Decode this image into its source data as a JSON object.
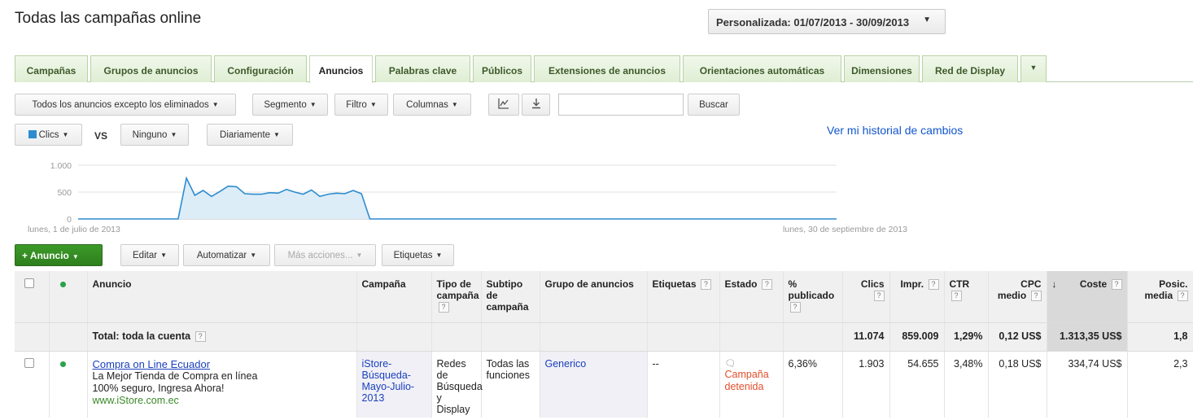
{
  "page_title": "Todas las campañas online",
  "date_range": {
    "label": "Personalizada: 01/07/2013 - 30/09/2013"
  },
  "tabs": [
    "Campañas",
    "Grupos de anuncios",
    "Configuración",
    "Anuncios",
    "Palabras clave",
    "Públicos",
    "Extensiones de anuncios",
    "Orientaciones automáticas",
    "Dimensiones",
    "Red de Display"
  ],
  "tabs_active": "Anuncios",
  "toolbar": {
    "filter_view": "Todos los anuncios excepto los eliminados",
    "segment": "Segmento",
    "filter": "Filtro",
    "columns": "Columnas",
    "search_value": "",
    "search_button": "Buscar"
  },
  "chart_controls": {
    "metric": "Clics",
    "vs": "VS",
    "compare": "Ninguno",
    "interval": "Diariamente",
    "history_link": "Ver mi historial de cambios"
  },
  "chart_data": {
    "type": "area",
    "x_start_label": "lunes, 1 de julio de 2013",
    "x_end_label": "lunes, 30 de septiembre de 2013",
    "ytick_labels": [
      "1.000",
      "500",
      "0"
    ],
    "ylim": [
      0,
      1000
    ],
    "grid": true,
    "series": [
      {
        "values": [
          0,
          0,
          0,
          0,
          0,
          0,
          0,
          0,
          0,
          0,
          0,
          0,
          0,
          760,
          440,
          530,
          420,
          510,
          610,
          600,
          470,
          460,
          460,
          490,
          480,
          550,
          500,
          460,
          540,
          420,
          460,
          480,
          470,
          530,
          470,
          0,
          0,
          0,
          0,
          0,
          0,
          0,
          0,
          0,
          0,
          0,
          0,
          0,
          0,
          0,
          0,
          0,
          0,
          0,
          0,
          0,
          0,
          0,
          0,
          0,
          0,
          0,
          0,
          0,
          0,
          0,
          0,
          0,
          0,
          0,
          0,
          0,
          0,
          0,
          0,
          0,
          0,
          0,
          0,
          0,
          0,
          0,
          0,
          0,
          0,
          0,
          0,
          0,
          0,
          0,
          0,
          0
        ]
      }
    ],
    "color": "#2d8ccf",
    "fill": "#dcedf8"
  },
  "actions": {
    "new_ad": "+ Anuncio",
    "edit": "Editar",
    "automate": "Automatizar",
    "more_actions": "Más acciones...",
    "labels": "Etiquetas"
  },
  "table": {
    "headers": {
      "ad": "Anuncio",
      "campaign": "Campaña",
      "campaign_type": "Tipo de campaña",
      "campaign_subtype": "Subtipo de campaña",
      "ad_group": "Grupo de anuncios",
      "labels": "Etiquetas",
      "status": "Estado",
      "pct_published": "% publicado",
      "clicks": "Clics",
      "impr": "Impr.",
      "ctr": "CTR",
      "cpc": "CPC medio",
      "cost": "Coste",
      "position": "Posic. media"
    },
    "help_mark": "?",
    "sort_arrow": "↓",
    "total": {
      "label": "Total: toda la cuenta",
      "clicks": "11.074",
      "impr": "859.009",
      "ctr": "1,29%",
      "cpc": "0,12 US$",
      "cost": "1.313,35 US$",
      "position": "1,8"
    },
    "rows": [
      {
        "ad_title": "Compra on Line Ecuador",
        "ad_line1": "La Mejor Tienda de Compra en línea",
        "ad_line2": "100% seguro, Ingresa Ahora!",
        "ad_url": "www.iStore.com.ec",
        "campaign": "iStore-Búsqueda-Mayo-Julio-2013",
        "campaign_type": "Redes de Búsqueda y Display",
        "campaign_subtype": "Todas las funciones",
        "ad_group": "Generico",
        "labels": "--",
        "status_icon": "🗨",
        "status": "Campaña detenida",
        "pct_published": "6,36%",
        "clicks": "1.903",
        "impr": "54.655",
        "ctr": "3,48%",
        "cpc": "0,18 US$",
        "cost": "334,74 US$",
        "position": "2,3"
      }
    ]
  }
}
